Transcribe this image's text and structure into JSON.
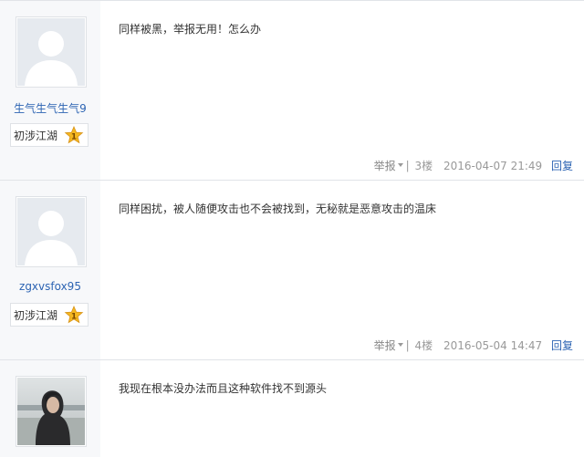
{
  "posts": [
    {
      "username": "生气生气生气9",
      "level": "初涉江湖",
      "level_number": "1",
      "avatar": "default-avatar",
      "content": "同样被黑，举报无用！怎么办",
      "report_label": "举报",
      "separator": "|",
      "floor": "3楼",
      "time": "2016-04-07 21:49",
      "reply_label": "回复"
    },
    {
      "username": "zgxvsfox95",
      "level": "初涉江湖",
      "level_number": "1",
      "avatar": "default-avatar",
      "content": "同样困扰，被人随便攻击也不会被找到，无秘就是恶意攻击的温床",
      "report_label": "举报",
      "separator": "|",
      "floor": "4楼",
      "time": "2016-05-04 14:47",
      "reply_label": "回复"
    },
    {
      "avatar": "photo-avatar",
      "content": "我现在根本没办法而且这种软件找不到源头"
    }
  ],
  "colors": {
    "link": "#2d64b3",
    "sidebar_bg": "#f7f8fa",
    "meta_text": "#999999",
    "medal": "#f5b820"
  }
}
